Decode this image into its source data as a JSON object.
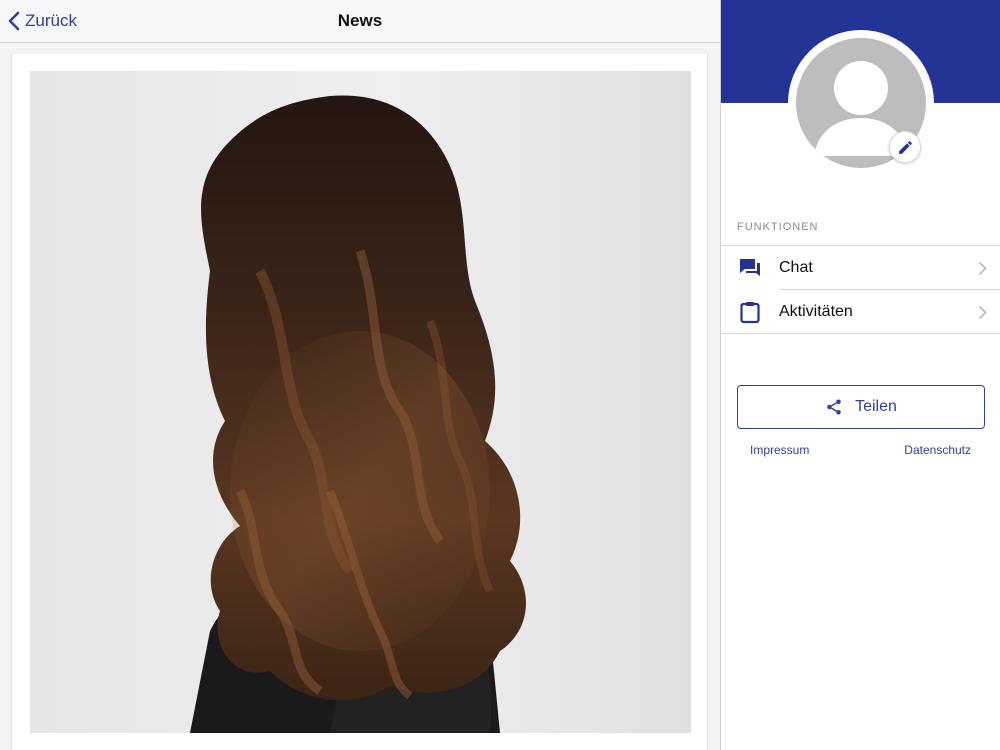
{
  "navbar": {
    "back_label": "Zurück",
    "title": "News"
  },
  "news": {
    "image_description_icon": "photo-long-wavy-brown-hair"
  },
  "sidebar": {
    "section_label": "FUNKTIONEN",
    "items": [
      {
        "label": "Chat",
        "icon": "chat-icon"
      },
      {
        "label": "Aktivitäten",
        "icon": "clipboard-icon"
      }
    ],
    "share_label": "Teilen",
    "links": {
      "impressum": "Impressum",
      "datenschutz": "Datenschutz"
    }
  },
  "colors": {
    "brand": "#233494",
    "accent": "#2f3f9e",
    "avatar_bg": "#bdbdbd"
  }
}
